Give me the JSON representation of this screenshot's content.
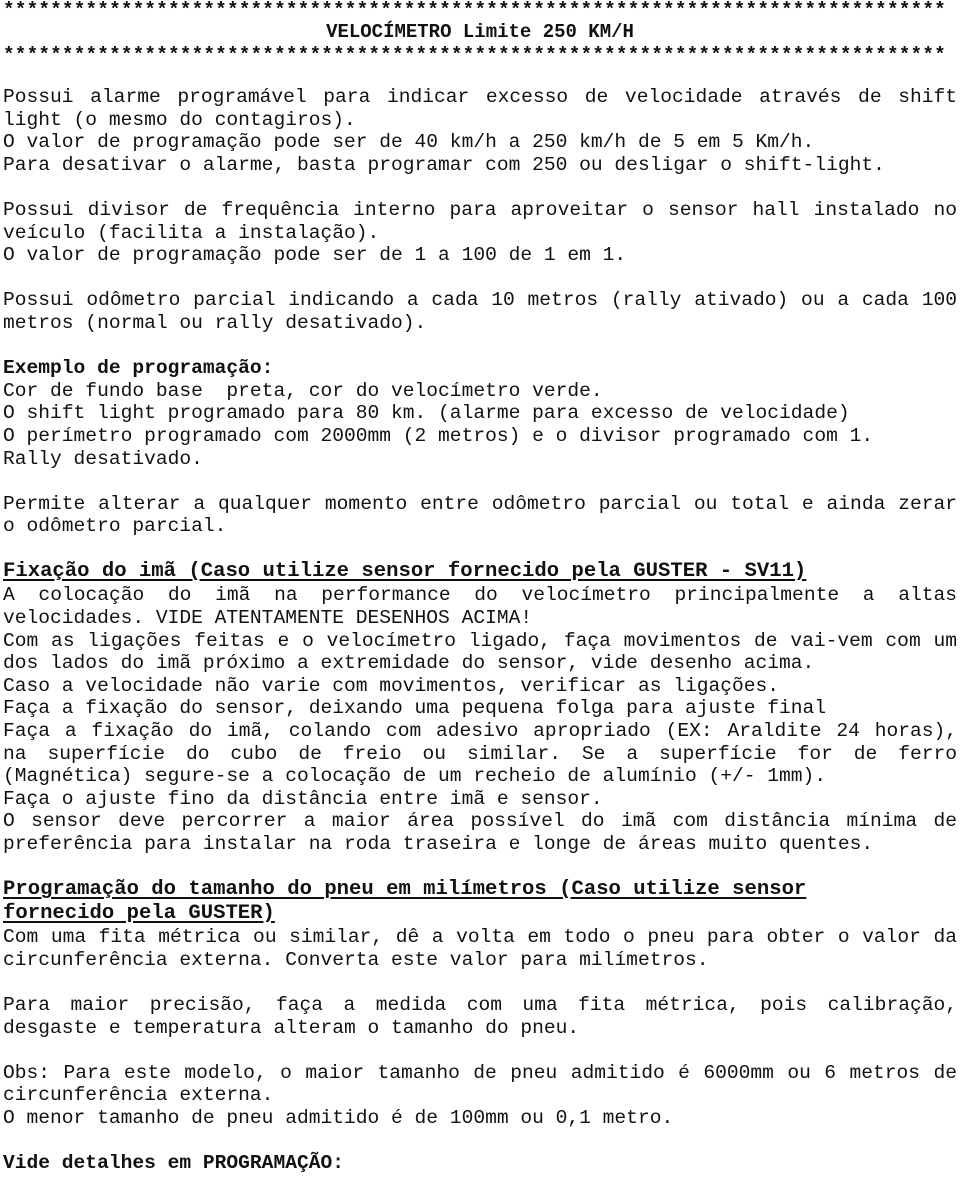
{
  "header": {
    "stars": "********************************************************************************",
    "title": "VELOCÍMETRO Limite 250 KM/H"
  },
  "sections": {
    "alarm": [
      "Possui alarme programável para indicar excesso de velocidade através de shift",
      "light (o mesmo do contagiros).",
      "O valor de programação pode ser de 40 km/h a 250 km/h de 5 em 5 Km/h.",
      "Para desativar o alarme, basta programar com 250 ou desligar o shift-light."
    ],
    "divisor": [
      "Possui divisor de frequência interno para aproveitar o sensor hall instalado no",
      "veículo (facilita a instalação).",
      "O valor de programação pode ser de 1 a 100 de 1 em 1."
    ],
    "odometer": [
      "Possui odômetro parcial indicando a cada 10 metros (rally ativado) ou a cada 100",
      "metros (normal ou rally desativado)."
    ],
    "example": {
      "heading": "Exemplo de programação:",
      "lines": [
        "Cor de fundo base  preta, cor do velocímetro verde.",
        "O shift light programado para 80 km. (alarme para excesso de velocidade)",
        "O perímetro programado com 2000mm (2 metros) e o divisor programado com 1.",
        "Rally desativado."
      ]
    },
    "permit": [
      "Permite alterar a qualquer momento entre odômetro parcial ou total e ainda zerar",
      "o odômetro parcial."
    ],
    "magnet": {
      "heading": "Fixação do imã (Caso utilize sensor fornecido pela GUSTER - SV11)",
      "lines": [
        "A colocação do imã na performance do velocímetro principalmente a altas",
        "velocidades. VIDE ATENTAMENTE DESENHOS ACIMA!",
        "Com as ligações feitas e o velocímetro ligado, faça movimentos de vai-vem com um",
        "dos lados do imã próximo a extremidade do sensor, vide desenho acima.",
        "Caso a velocidade não varie com movimentos, verificar as ligações.",
        "Faça a fixação do sensor, deixando uma pequena folga para ajuste final",
        "Faça a fixação do imã, colando com adesivo apropriado (EX: Araldite 24 horas),",
        "na superfície do cubo de freio ou similar. Se a superfície for de ferro",
        "(Magnética) segure-se a colocação de um recheio de alumínio (+/- 1mm).",
        "Faça o ajuste fino da distância entre imã e sensor.",
        "O sensor deve percorrer a maior área possível do imã com distância mínima de",
        "preferência para instalar na roda traseira e longe de áreas muito quentes."
      ]
    },
    "tire": {
      "heading_line1": "Programação do tamanho do pneu em milímetros (Caso utilize sensor",
      "heading_line2": "fornecido pela GUSTER)",
      "lines": [
        "Com uma fita métrica ou similar, dê a volta em todo o pneu para obter o valor da",
        "circunferência externa. Converta este valor para milímetros."
      ],
      "precision": [
        "Para maior precisão, faça a medida com uma fita métrica, pois calibração,",
        "desgaste e temperatura alteram o tamanho do pneu."
      ],
      "obs": [
        "Obs: Para este modelo, o maior tamanho de pneu admitido é 6000mm ou 6 metros de",
        "circunferência externa.",
        "O menor tamanho de pneu admitido é de 100mm ou 0,1 metro."
      ]
    },
    "footer": {
      "see_details": "Vide detalhes em PROGRAMAÇÃO:"
    }
  }
}
